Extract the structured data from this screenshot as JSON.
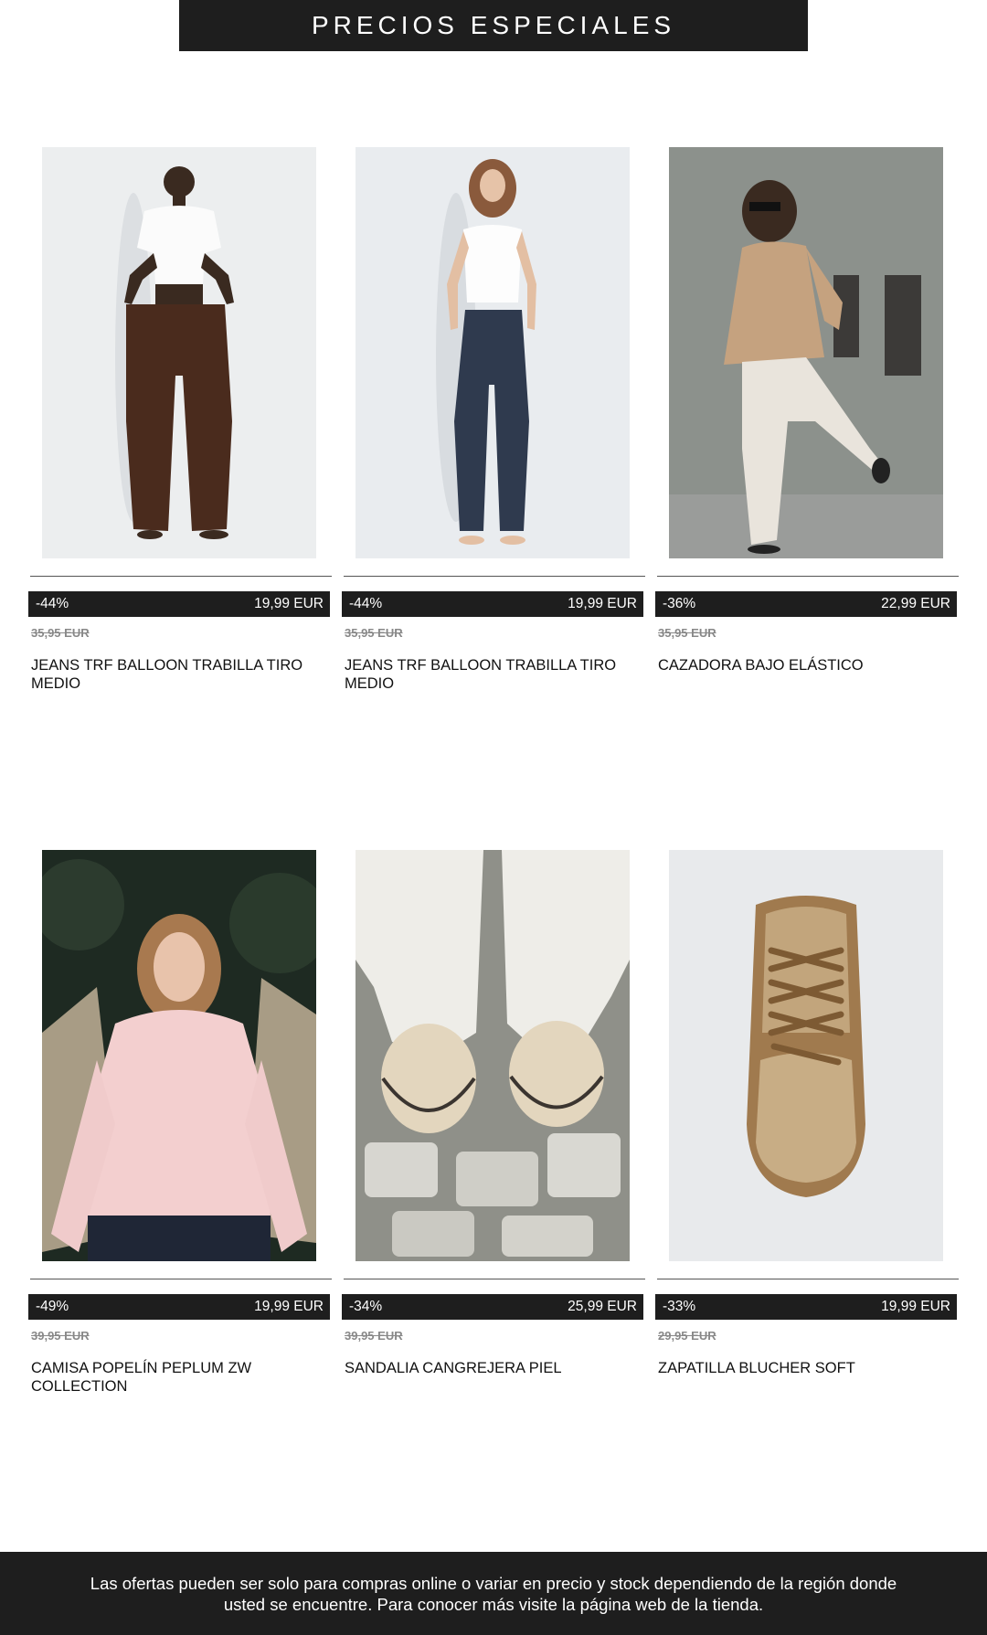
{
  "header": {
    "title": "PRECIOS ESPECIALES"
  },
  "products": [
    {
      "discount": "-44%",
      "price": "19,99 EUR",
      "old_price": "35,95 EUR",
      "name": "JEANS TRF BALLOON TRABILLA TIRO MEDIO",
      "image": "brown-wide-jeans-photo"
    },
    {
      "discount": "-44%",
      "price": "19,99 EUR",
      "old_price": "35,95 EUR",
      "name": "JEANS TRF BALLOON TRABILLA TIRO MEDIO",
      "image": "dark-blue-jeans-photo"
    },
    {
      "discount": "-36%",
      "price": "22,99 EUR",
      "old_price": "35,95 EUR",
      "name": "CAZADORA BAJO ELÁSTICO",
      "image": "beige-jacket-photo"
    },
    {
      "discount": "-49%",
      "price": "19,99 EUR",
      "old_price": "39,95 EUR",
      "name": "CAMISA POPELÍN PEPLUM ZW COLLECTION",
      "image": "pink-shirt-photo"
    },
    {
      "discount": "-34%",
      "price": "25,99 EUR",
      "old_price": "39,95 EUR",
      "name": "SANDALIA CANGREJERA PIEL",
      "image": "leather-sandals-photo"
    },
    {
      "discount": "-33%",
      "price": "19,99 EUR",
      "old_price": "29,95 EUR",
      "name": "ZAPATILLA BLUCHER SOFT",
      "image": "suede-sneaker-photo"
    }
  ],
  "footer": {
    "disclaimer": "Las ofertas pueden ser solo para compras online o variar en precio y stock dependiendo de la región donde usted se encuentre. Para conocer más visite la página web de la tienda."
  },
  "colors": {
    "banner_bg": "#1e1e1e",
    "banner_text": "#ffffff",
    "old_price": "#888888"
  }
}
